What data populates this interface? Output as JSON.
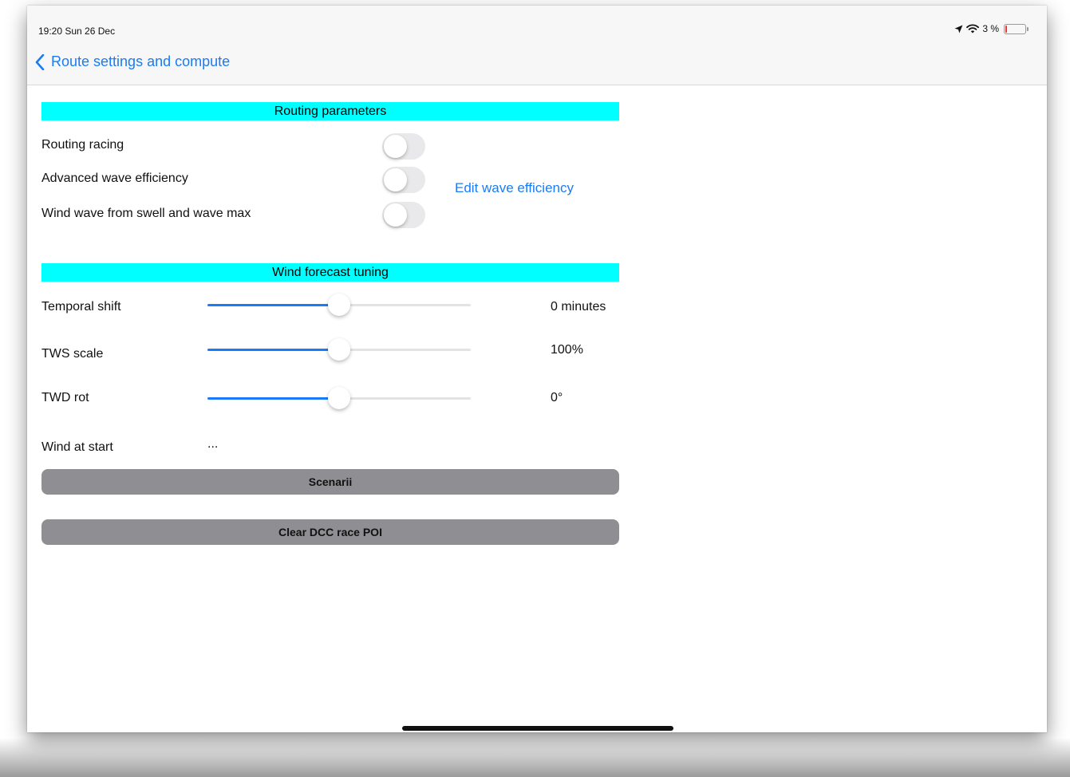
{
  "status_bar": {
    "time": "19:20  Sun 26 Dec",
    "battery_text": "3 %",
    "battery_level": 0.06
  },
  "nav": {
    "back_label": "Route settings and compute"
  },
  "routing": {
    "header": "Routing parameters",
    "racing_label": "Routing racing",
    "racing_on": false,
    "wave_eff_label": "Advanced wave efficiency",
    "wave_eff_on": false,
    "edit_wave_link": "Edit wave efficiency",
    "wind_wave_label": "Wind wave from swell and wave max",
    "wind_wave_on": false
  },
  "wind_tuning": {
    "header": "Wind forecast tuning",
    "temporal_label": "Temporal shift",
    "temporal_value": "0 minutes",
    "temporal_position": 0.5,
    "tws_label": "TWS scale",
    "tws_value": "100%",
    "tws_position": 0.5,
    "twd_label": "TWD rot",
    "twd_value": "0°",
    "twd_position": 0.5,
    "wind_start_label": "Wind at start",
    "wind_start_value": "..."
  },
  "actions": {
    "scenarii_label": "Scenarii",
    "clear_dcc_label": "Clear DCC race POI"
  },
  "colors": {
    "accent": "#1a7cf5",
    "section_header": "#00ffff",
    "button_gray": "#8e8e93",
    "toggle_off": "#e9e9eb"
  }
}
